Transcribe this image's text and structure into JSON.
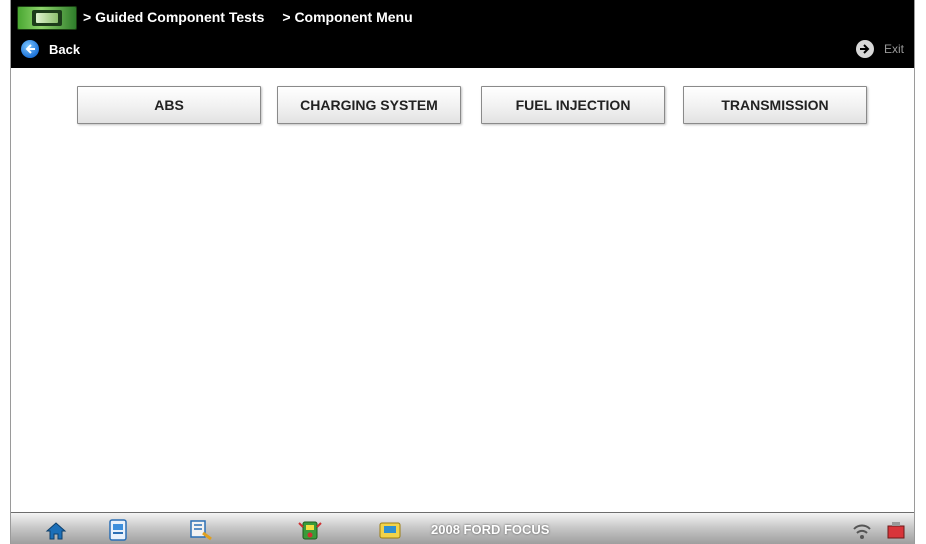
{
  "header": {
    "breadcrumb": [
      "> Guided Component Tests",
      "> Component Menu"
    ],
    "back_label": "Back",
    "exit_label": "Exit"
  },
  "menu": {
    "items": [
      {
        "label": "ABS"
      },
      {
        "label": "CHARGING SYSTEM"
      },
      {
        "label": "FUEL INJECTION"
      },
      {
        "label": "TRANSMISSION"
      }
    ]
  },
  "toolbar": {
    "vehicle": "2008 FORD FOCUS",
    "icons": [
      "home-icon",
      "scanner-icon",
      "tools-icon",
      "multimeter-icon",
      "data-icon",
      "wifi-icon",
      "battery-icon"
    ]
  },
  "colors": {
    "titlebar": "#000000",
    "back_icon": "#1e73d8",
    "logo_green": "#4aa832"
  }
}
